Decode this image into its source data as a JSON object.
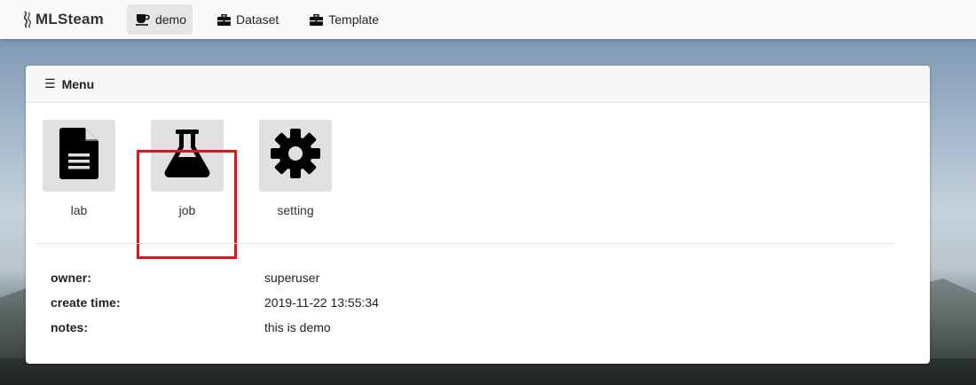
{
  "brand": {
    "name": "MLSteam"
  },
  "nav": {
    "items": [
      {
        "label": "demo",
        "icon": "coffee-cup-icon",
        "active": true
      },
      {
        "label": "Dataset",
        "icon": "briefcase-icon",
        "active": false
      },
      {
        "label": "Template",
        "icon": "briefcase-icon",
        "active": false
      }
    ]
  },
  "menu": {
    "title": "Menu",
    "icon": "hamburger-icon",
    "apps": [
      {
        "label": "lab",
        "icon": "document-icon"
      },
      {
        "label": "job",
        "icon": "flask-icon",
        "highlighted": true
      },
      {
        "label": "setting",
        "icon": "gear-icon"
      }
    ]
  },
  "info": {
    "rows": [
      {
        "key": "owner:",
        "value": "superuser"
      },
      {
        "key": "create time:",
        "value": "2019-11-22 13:55:34"
      },
      {
        "key": "notes:",
        "value": "this is demo"
      }
    ]
  },
  "colors": {
    "highlight": "#e0141b",
    "tile": "#e0e0e0",
    "active_nav": "#e6e6e6"
  }
}
